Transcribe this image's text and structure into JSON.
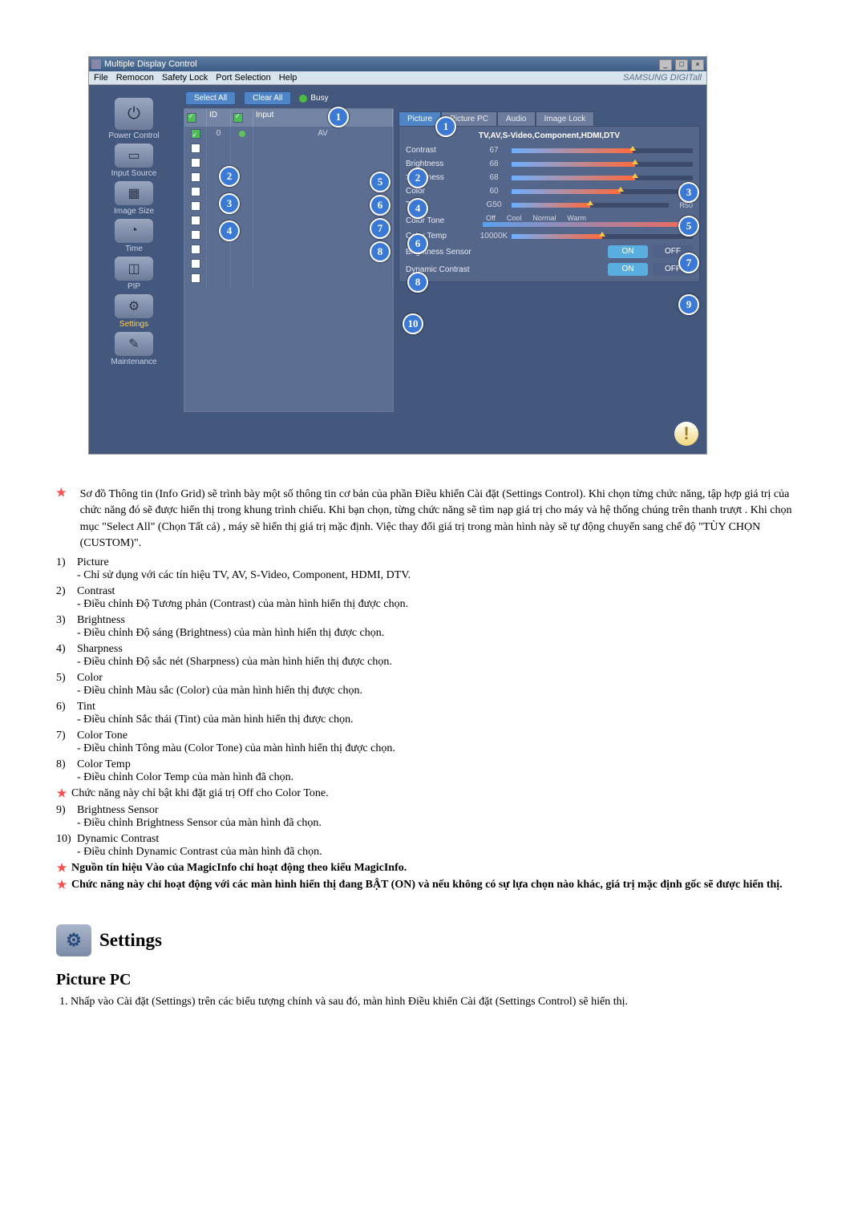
{
  "window": {
    "title": "Multiple Display Control",
    "menu": [
      "File",
      "Remocon",
      "Safety Lock",
      "Port Selection",
      "Help"
    ],
    "brand": "SAMSUNG DIGITall"
  },
  "sidebar": [
    {
      "key": "power",
      "label": "Power Control",
      "glyph": "⏻"
    },
    {
      "key": "input",
      "label": "Input Source",
      "glyph": "▭"
    },
    {
      "key": "image",
      "label": "Image Size",
      "glyph": "▦"
    },
    {
      "key": "time",
      "label": "Time",
      "glyph": "◔"
    },
    {
      "key": "pip",
      "label": "PIP",
      "glyph": "◫"
    },
    {
      "key": "settings",
      "label": "Settings",
      "glyph": "⚙",
      "active": true
    },
    {
      "key": "maint",
      "label": "Maintenance",
      "glyph": "✎"
    }
  ],
  "actions": {
    "select_all": "Select All",
    "clear_all": "Clear All",
    "busy": "Busy"
  },
  "grid": {
    "headers": [
      "",
      "ID",
      "",
      "Input"
    ],
    "rows": [
      {
        "checked": true,
        "id": "0",
        "led": true,
        "input": "AV"
      },
      {
        "checked": false,
        "id": "",
        "led": false,
        "input": ""
      },
      {
        "checked": false,
        "id": "",
        "led": false,
        "input": ""
      },
      {
        "checked": false,
        "id": "",
        "led": false,
        "input": ""
      },
      {
        "checked": false,
        "id": "",
        "led": false,
        "input": ""
      },
      {
        "checked": false,
        "id": "",
        "led": false,
        "input": ""
      },
      {
        "checked": false,
        "id": "",
        "led": false,
        "input": ""
      },
      {
        "checked": false,
        "id": "",
        "led": false,
        "input": ""
      },
      {
        "checked": false,
        "id": "",
        "led": false,
        "input": ""
      },
      {
        "checked": false,
        "id": "",
        "led": false,
        "input": ""
      },
      {
        "checked": false,
        "id": "",
        "led": false,
        "input": ""
      }
    ]
  },
  "tabs": [
    "Picture",
    "Picture PC",
    "Audio",
    "Image Lock"
  ],
  "panel": {
    "signal": "TV,AV,S-Video,Component,HDMI,DTV",
    "controls": [
      {
        "label": "Contrast",
        "value": "67",
        "pct": 67
      },
      {
        "label": "Brightness",
        "value": "68",
        "pct": 68
      },
      {
        "label": "Sharpness",
        "value": "68",
        "pct": 68
      },
      {
        "label": "Color",
        "value": "60",
        "pct": 60
      },
      {
        "label": "Tint",
        "value": "G50",
        "pct": 50,
        "right": "R50"
      }
    ],
    "color_tone": {
      "label": "Color Tone",
      "opts": [
        "Off",
        "Cool",
        "Normal",
        "Warm"
      ]
    },
    "color_temp": {
      "label": "Color Temp",
      "value": "10000K",
      "pct": 50
    },
    "bsensor": {
      "label": "Brightness Sensor",
      "on": "ON",
      "off": "OFF"
    },
    "dyncon": {
      "label": "Dynamic Contrast",
      "on": "ON",
      "off": "OFF"
    }
  },
  "callouts": [
    "1",
    "2",
    "3",
    "4",
    "5",
    "6",
    "7",
    "8",
    "9",
    "10"
  ],
  "description": {
    "intro": "Sơ đồ Thông tin (Info Grid) sẽ trình bày một số thông tin cơ bản của phần Điều khiển Cài đặt (Settings Control). Khi chọn từng chức năng, tập hợp giá trị của chức năng đó sẽ được hiển thị trong khung trình chiếu. Khi bạn chọn, từng chức năng sẽ tìm nạp giá trị cho máy và hệ thống chúng trên thanh trượt . Khi chọn mục \"Select All\" (Chọn Tất cả) , máy sẽ hiển thị giá trị mặc định. Việc thay đổi giá trị trong màn hình này sẽ tự động chuyển sang chế độ \"TÙY CHỌN (CUSTOM)\".",
    "items": [
      {
        "num": "1)",
        "term": "Picture",
        "sub": "- Chỉ sử dụng với các tín hiệu TV, AV, S-Video, Component, HDMI, DTV."
      },
      {
        "num": "2)",
        "term": "Contrast",
        "sub": "- Điều chỉnh Độ Tương phản (Contrast) của màn hình hiển thị được chọn."
      },
      {
        "num": "3)",
        "term": "Brightness",
        "sub": "- Điều chỉnh Độ sáng (Brightness) của màn hình hiển thị được chọn."
      },
      {
        "num": "4)",
        "term": "Sharpness",
        "sub": "- Điều chỉnh Độ sắc nét (Sharpness) của màn hình hiển thị được chọn."
      },
      {
        "num": "5)",
        "term": "Color",
        "sub": "- Điều chỉnh Màu sắc (Color) của màn hình hiển thị được chọn."
      },
      {
        "num": "6)",
        "term": "Tint",
        "sub": "- Điều chỉnh Sắc thái (Tint) của màn hình hiển thị được chọn."
      },
      {
        "num": "7)",
        "term": "Color Tone",
        "sub": "- Điều chỉnh Tông màu (Color Tone) của màn hình hiển thị được chọn."
      },
      {
        "num": "8)",
        "term": "Color Temp",
        "sub": "- Điều chỉnh Color Temp của màn hình đã chọn."
      }
    ],
    "star_note1": "Chức năng này chỉ bật khi đặt giá trị Off cho Color Tone.",
    "items2": [
      {
        "num": "9)",
        "term": "Brightness Sensor",
        "sub": "- Điều chỉnh Brightness Sensor của màn hình đã chọn."
      },
      {
        "num": "10)",
        "term": "Dynamic Contrast",
        "sub": "- Điều chỉnh Dynamic Contrast của màn hình đã chọn."
      }
    ],
    "star_note2": "Nguồn tín hiệu Vào của MagicInfo chỉ hoạt động theo kiểu MagicInfo.",
    "star_note3": "Chức năng này chỉ hoạt động với các màn hình hiển thị đang BẬT (ON) và nếu không có sự lựa chọn nào khác, giá trị mặc định gốc sẽ được hiển thị."
  },
  "section": {
    "title": "Settings",
    "subtitle": "Picture PC",
    "step1": "Nhấp vào Cài đặt (Settings) trên các biểu tượng chính và sau đó, màn hình Điều khiển Cài đặt (Settings Control) sẽ hiển thị."
  }
}
